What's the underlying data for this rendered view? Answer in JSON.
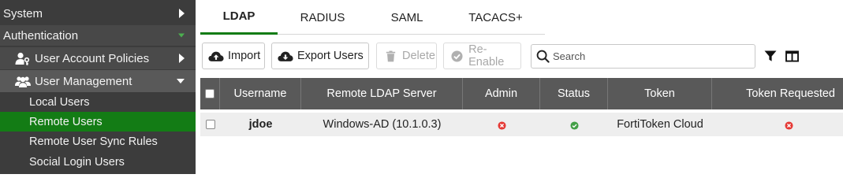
{
  "sidebar": {
    "system": "System",
    "authentication": "Authentication",
    "user_account_policies": "User Account Policies",
    "user_management": "User Management",
    "sub_items": [
      "Local Users",
      "Remote Users",
      "Remote User Sync Rules",
      "Social Login Users"
    ],
    "active_item": "Remote Users"
  },
  "tabs": [
    "LDAP",
    "RADIUS",
    "SAML",
    "TACACS+"
  ],
  "active_tab": "LDAP",
  "toolbar": {
    "import_label": "Import",
    "export_label": "Export Users",
    "delete_label": "Delete",
    "reenable_label": "Re-Enable",
    "search_placeholder": "Search"
  },
  "table": {
    "columns": [
      "Username",
      "Remote LDAP Server",
      "Admin",
      "Status",
      "Token",
      "Token Requested"
    ],
    "rows": [
      {
        "username": "jdoe",
        "server": "Windows-AD (10.1.0.3)",
        "admin": "no",
        "status": "enabled",
        "token": "FortiToken Cloud",
        "token_requested": "no"
      }
    ]
  },
  "colors": {
    "accent_green": "#137c15",
    "status_red": "#e53935",
    "status_green": "#43a047",
    "sidebar_bg": "#3c3c3c",
    "header_bg": "#595959"
  },
  "icons": {
    "import": "cloud-upload-icon",
    "export": "cloud-download-icon",
    "delete": "trash-icon",
    "reenable": "check-circle-icon",
    "search": "search-icon",
    "filter": "filter-icon",
    "columns": "columns-icon",
    "admin": "x-circle-icon",
    "status": "check-circle-icon",
    "token_requested": "x-circle-icon"
  }
}
